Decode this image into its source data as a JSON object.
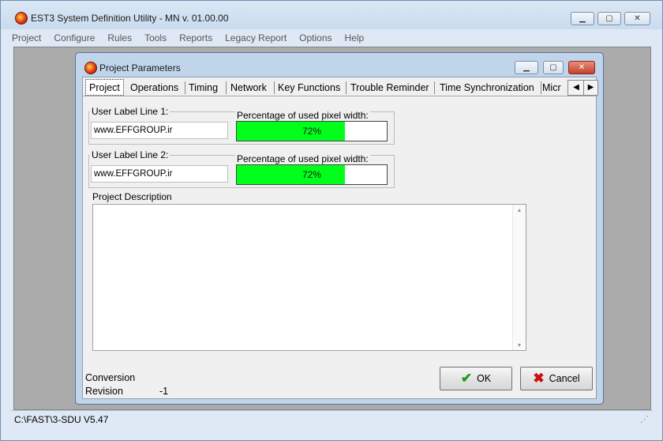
{
  "window": {
    "title": "EST3 System Definition Utility - MN v. 01.00.00"
  },
  "menu": [
    "Project",
    "Configure",
    "Rules",
    "Tools",
    "Reports",
    "Legacy Report",
    "Options",
    "Help"
  ],
  "dialog": {
    "title": "Project Parameters",
    "tabs": [
      "Project",
      "Operations",
      "Timing",
      "Network",
      "Key Functions",
      "Trouble Reminder",
      "Time Synchronization",
      "Micr"
    ],
    "active_tab": "Project",
    "line1": {
      "label": "User Label Line 1:",
      "value": "www.EFFGROUP.ir",
      "pct_label": "Percentage of used pixel width:",
      "percent": 72,
      "percent_text": "72%"
    },
    "line2": {
      "label": "User Label Line 2:",
      "value": "www.EFFGROUP.ir",
      "pct_label": "Percentage of used pixel width:",
      "percent": 72,
      "percent_text": "72%"
    },
    "description_label": "Project Description",
    "description_value": "",
    "conversion_label": "Conversion",
    "revision_label": "Revision",
    "revision_value": "-1",
    "ok_label": "OK",
    "cancel_label": "Cancel"
  },
  "status": {
    "path": "C:\\FAST\\3-SDU V5.47"
  },
  "colors": {
    "progress_fill": "#00ff1a",
    "ok_check": "#1e9e1e",
    "cancel_x": "#cc1010"
  },
  "icons": [
    "app-icon",
    "minimize-icon",
    "maximize-icon",
    "close-icon",
    "tab-scroll-left-icon",
    "tab-scroll-right-icon",
    "check-icon",
    "x-icon",
    "size-grip-icon"
  ]
}
